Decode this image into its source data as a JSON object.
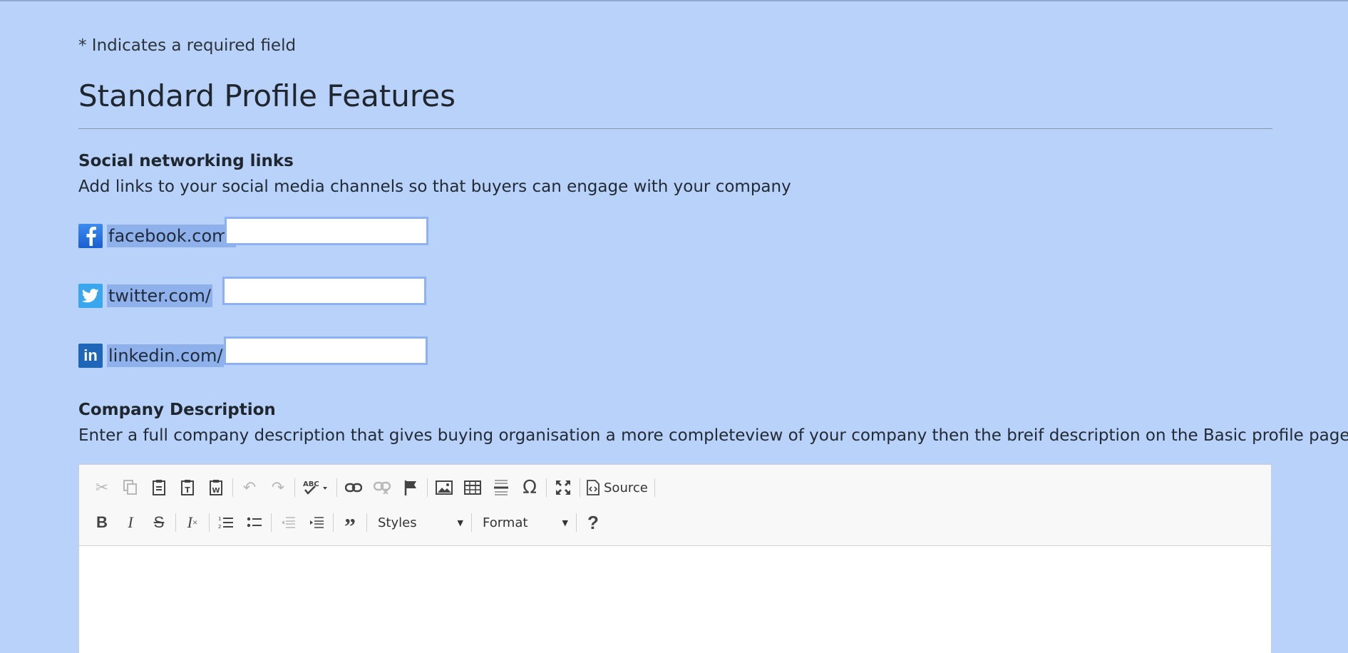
{
  "required_note": "* Indicates a required field",
  "page_title": "Standard Profile Features",
  "social": {
    "title": "Social networking links",
    "description": "Add links to your social media channels so that buyers can engage with your company",
    "links": [
      {
        "icon": "facebook-icon",
        "glyph": "f",
        "prefix": "facebook.com/",
        "value": ""
      },
      {
        "icon": "twitter-icon",
        "glyph": "🐦",
        "prefix": "twitter.com/",
        "value": ""
      },
      {
        "icon": "linkedin-icon",
        "glyph": "in",
        "prefix": "linkedin.com/",
        "value": ""
      }
    ]
  },
  "company": {
    "title": "Company Description",
    "description": "Enter a full company description that gives buying organisation a more completeview of your company then the breif description on the Basic profile page"
  },
  "editor": {
    "source_label": "Source",
    "styles_label": "Styles",
    "format_label": "Format",
    "content": ""
  }
}
